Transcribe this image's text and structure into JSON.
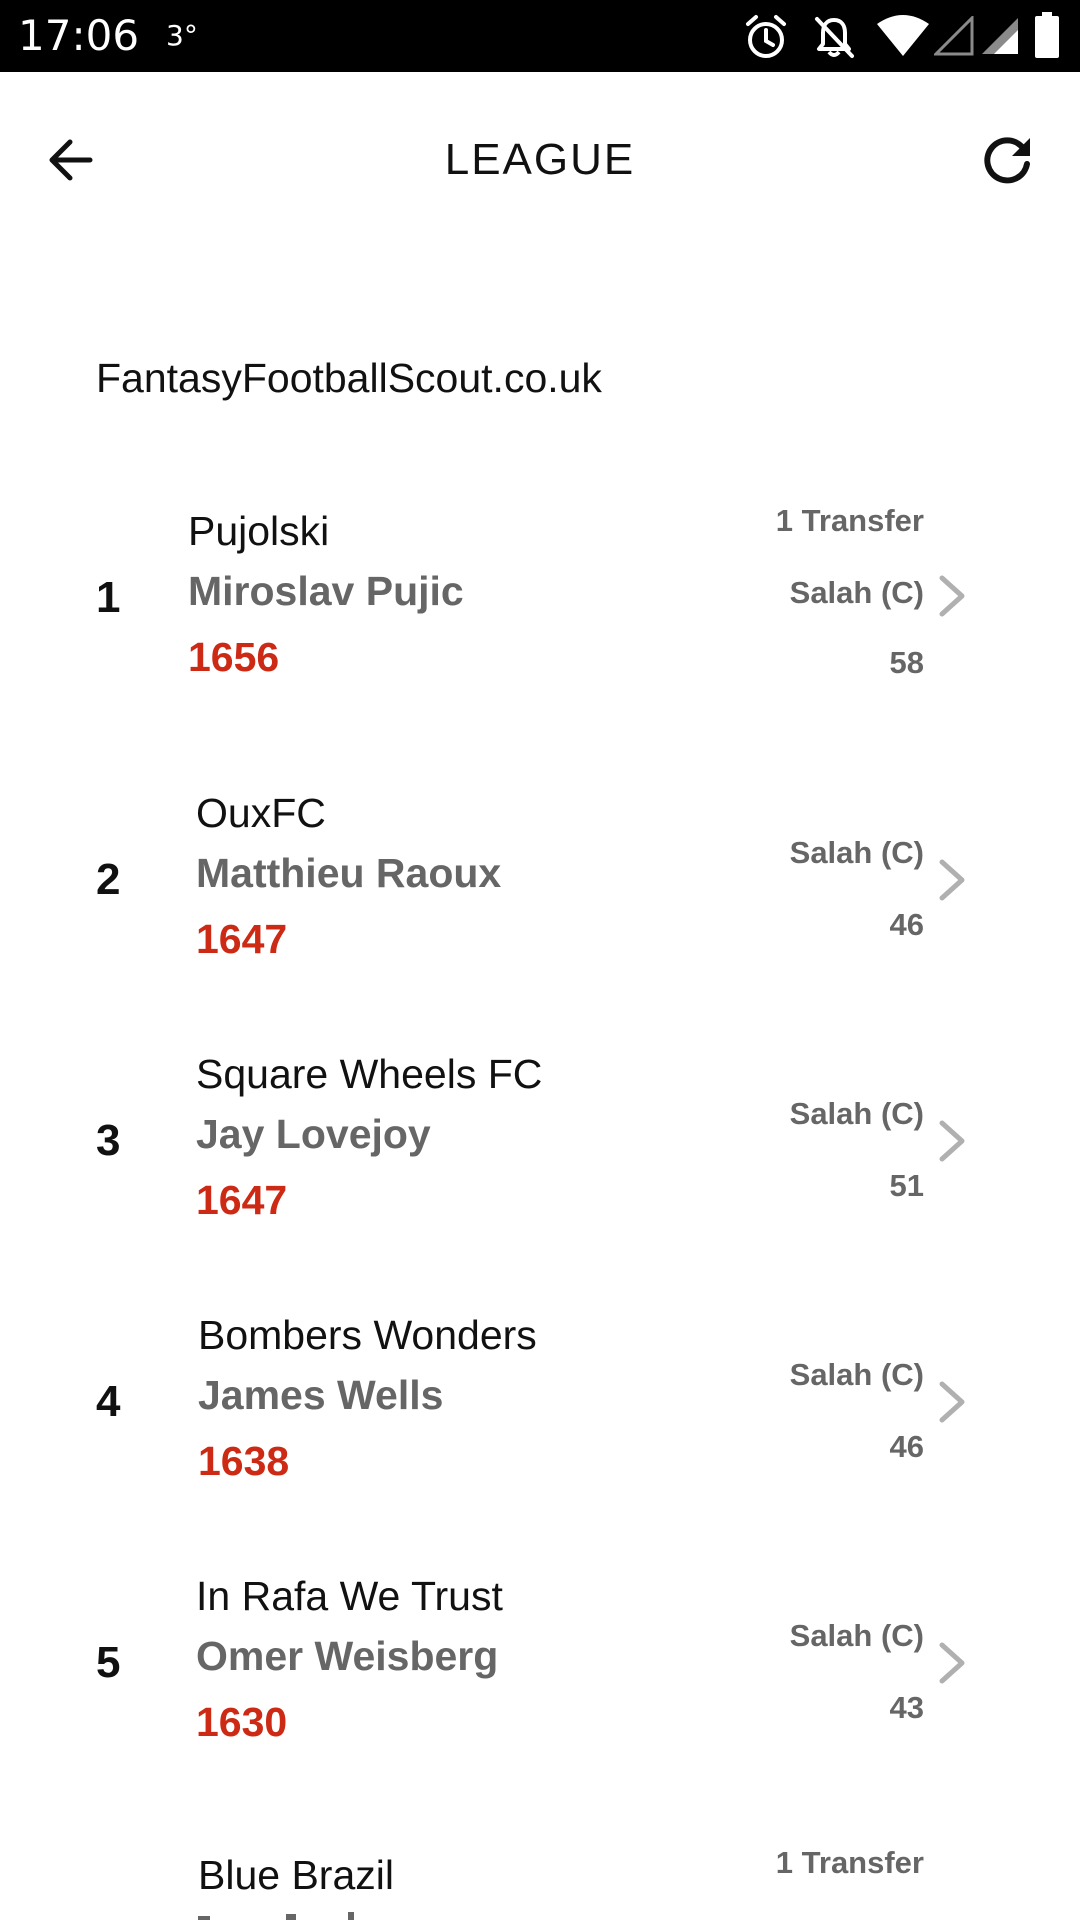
{
  "status_bar": {
    "time": "17:06",
    "temperature": "3°",
    "icons": [
      "alarm-icon",
      "notifications-off-icon",
      "wifi-icon",
      "signal-icon",
      "signal-icon",
      "battery-icon"
    ]
  },
  "header": {
    "title": "LEAGUE",
    "back_icon": "arrow-left-icon",
    "refresh_icon": "refresh-icon"
  },
  "league": {
    "name": "FantasyFootballScout.co.uk"
  },
  "standings": [
    {
      "rank": "1",
      "team": "Pujolski",
      "manager": "Miroslav Pujic",
      "total": "1656",
      "transfers": "1 Transfer",
      "captain": "Salah (C)",
      "gw_points": "58"
    },
    {
      "rank": "2",
      "team": "OuxFC",
      "manager": "Matthieu Raoux",
      "total": "1647",
      "transfers": "",
      "captain": "Salah (C)",
      "gw_points": "46"
    },
    {
      "rank": "3",
      "team": "Square Wheels FC",
      "manager": "Jay Lovejoy",
      "total": "1647",
      "transfers": "",
      "captain": "Salah (C)",
      "gw_points": "51"
    },
    {
      "rank": "4",
      "team": "Bombers Wonders",
      "manager": "James Wells",
      "total": "1638",
      "transfers": "",
      "captain": "Salah (C)",
      "gw_points": "46"
    },
    {
      "rank": "5",
      "team": "In Rafa We Trust",
      "manager": "Omer Weisberg",
      "total": "1630",
      "transfers": "",
      "captain": "Salah (C)",
      "gw_points": "43"
    },
    {
      "rank": "",
      "team": "Blue Brazil",
      "manager": "",
      "total": "",
      "transfers": "1 Transfer",
      "captain": "",
      "gw_points": ""
    }
  ],
  "colors": {
    "points": "#cc2a14",
    "secondary_text": "#666666",
    "primary_text": "#111111",
    "chevron": "#b0b0b0"
  }
}
